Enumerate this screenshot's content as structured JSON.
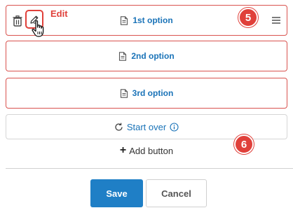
{
  "options": [
    {
      "label": "1st option",
      "icon": "document-icon"
    },
    {
      "label": "2nd option",
      "icon": "document-icon"
    },
    {
      "label": "3rd option",
      "icon": "document-icon"
    }
  ],
  "edit_caption": "Edit",
  "badges": {
    "first": "5",
    "second": "6"
  },
  "start_over": {
    "label": "Start over",
    "icon": "refresh-icon",
    "info_icon": "info-icon"
  },
  "add_button": {
    "plus": "+",
    "label": "Add button"
  },
  "footer": {
    "save_label": "Save",
    "cancel_label": "Cancel"
  },
  "colors": {
    "accent_red": "#e0403a",
    "link_blue": "#1a73b8",
    "save_blue": "#1f7fc6"
  }
}
